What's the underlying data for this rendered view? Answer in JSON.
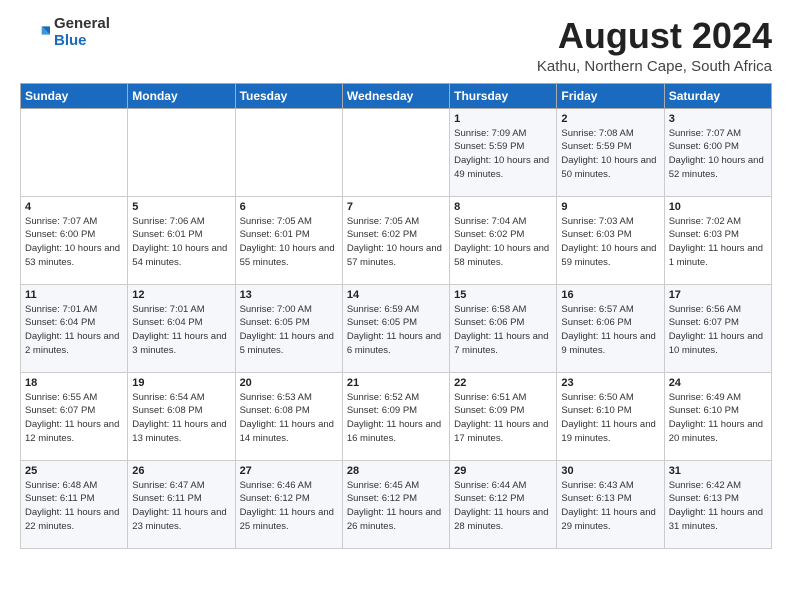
{
  "header": {
    "logo_general": "General",
    "logo_blue": "Blue",
    "title": "August 2024",
    "subtitle": "Kathu, Northern Cape, South Africa"
  },
  "weekdays": [
    "Sunday",
    "Monday",
    "Tuesday",
    "Wednesday",
    "Thursday",
    "Friday",
    "Saturday"
  ],
  "weeks": [
    [
      {
        "day": "",
        "info": ""
      },
      {
        "day": "",
        "info": ""
      },
      {
        "day": "",
        "info": ""
      },
      {
        "day": "",
        "info": ""
      },
      {
        "day": "1",
        "info": "Sunrise: 7:09 AM\nSunset: 5:59 PM\nDaylight: 10 hours\nand 49 minutes."
      },
      {
        "day": "2",
        "info": "Sunrise: 7:08 AM\nSunset: 5:59 PM\nDaylight: 10 hours\nand 50 minutes."
      },
      {
        "day": "3",
        "info": "Sunrise: 7:07 AM\nSunset: 6:00 PM\nDaylight: 10 hours\nand 52 minutes."
      }
    ],
    [
      {
        "day": "4",
        "info": "Sunrise: 7:07 AM\nSunset: 6:00 PM\nDaylight: 10 hours\nand 53 minutes."
      },
      {
        "day": "5",
        "info": "Sunrise: 7:06 AM\nSunset: 6:01 PM\nDaylight: 10 hours\nand 54 minutes."
      },
      {
        "day": "6",
        "info": "Sunrise: 7:05 AM\nSunset: 6:01 PM\nDaylight: 10 hours\nand 55 minutes."
      },
      {
        "day": "7",
        "info": "Sunrise: 7:05 AM\nSunset: 6:02 PM\nDaylight: 10 hours\nand 57 minutes."
      },
      {
        "day": "8",
        "info": "Sunrise: 7:04 AM\nSunset: 6:02 PM\nDaylight: 10 hours\nand 58 minutes."
      },
      {
        "day": "9",
        "info": "Sunrise: 7:03 AM\nSunset: 6:03 PM\nDaylight: 10 hours\nand 59 minutes."
      },
      {
        "day": "10",
        "info": "Sunrise: 7:02 AM\nSunset: 6:03 PM\nDaylight: 11 hours\nand 1 minute."
      }
    ],
    [
      {
        "day": "11",
        "info": "Sunrise: 7:01 AM\nSunset: 6:04 PM\nDaylight: 11 hours\nand 2 minutes."
      },
      {
        "day": "12",
        "info": "Sunrise: 7:01 AM\nSunset: 6:04 PM\nDaylight: 11 hours\nand 3 minutes."
      },
      {
        "day": "13",
        "info": "Sunrise: 7:00 AM\nSunset: 6:05 PM\nDaylight: 11 hours\nand 5 minutes."
      },
      {
        "day": "14",
        "info": "Sunrise: 6:59 AM\nSunset: 6:05 PM\nDaylight: 11 hours\nand 6 minutes."
      },
      {
        "day": "15",
        "info": "Sunrise: 6:58 AM\nSunset: 6:06 PM\nDaylight: 11 hours\nand 7 minutes."
      },
      {
        "day": "16",
        "info": "Sunrise: 6:57 AM\nSunset: 6:06 PM\nDaylight: 11 hours\nand 9 minutes."
      },
      {
        "day": "17",
        "info": "Sunrise: 6:56 AM\nSunset: 6:07 PM\nDaylight: 11 hours\nand 10 minutes."
      }
    ],
    [
      {
        "day": "18",
        "info": "Sunrise: 6:55 AM\nSunset: 6:07 PM\nDaylight: 11 hours\nand 12 minutes."
      },
      {
        "day": "19",
        "info": "Sunrise: 6:54 AM\nSunset: 6:08 PM\nDaylight: 11 hours\nand 13 minutes."
      },
      {
        "day": "20",
        "info": "Sunrise: 6:53 AM\nSunset: 6:08 PM\nDaylight: 11 hours\nand 14 minutes."
      },
      {
        "day": "21",
        "info": "Sunrise: 6:52 AM\nSunset: 6:09 PM\nDaylight: 11 hours\nand 16 minutes."
      },
      {
        "day": "22",
        "info": "Sunrise: 6:51 AM\nSunset: 6:09 PM\nDaylight: 11 hours\nand 17 minutes."
      },
      {
        "day": "23",
        "info": "Sunrise: 6:50 AM\nSunset: 6:10 PM\nDaylight: 11 hours\nand 19 minutes."
      },
      {
        "day": "24",
        "info": "Sunrise: 6:49 AM\nSunset: 6:10 PM\nDaylight: 11 hours\nand 20 minutes."
      }
    ],
    [
      {
        "day": "25",
        "info": "Sunrise: 6:48 AM\nSunset: 6:11 PM\nDaylight: 11 hours\nand 22 minutes."
      },
      {
        "day": "26",
        "info": "Sunrise: 6:47 AM\nSunset: 6:11 PM\nDaylight: 11 hours\nand 23 minutes."
      },
      {
        "day": "27",
        "info": "Sunrise: 6:46 AM\nSunset: 6:12 PM\nDaylight: 11 hours\nand 25 minutes."
      },
      {
        "day": "28",
        "info": "Sunrise: 6:45 AM\nSunset: 6:12 PM\nDaylight: 11 hours\nand 26 minutes."
      },
      {
        "day": "29",
        "info": "Sunrise: 6:44 AM\nSunset: 6:12 PM\nDaylight: 11 hours\nand 28 minutes."
      },
      {
        "day": "30",
        "info": "Sunrise: 6:43 AM\nSunset: 6:13 PM\nDaylight: 11 hours\nand 29 minutes."
      },
      {
        "day": "31",
        "info": "Sunrise: 6:42 AM\nSunset: 6:13 PM\nDaylight: 11 hours\nand 31 minutes."
      }
    ]
  ]
}
